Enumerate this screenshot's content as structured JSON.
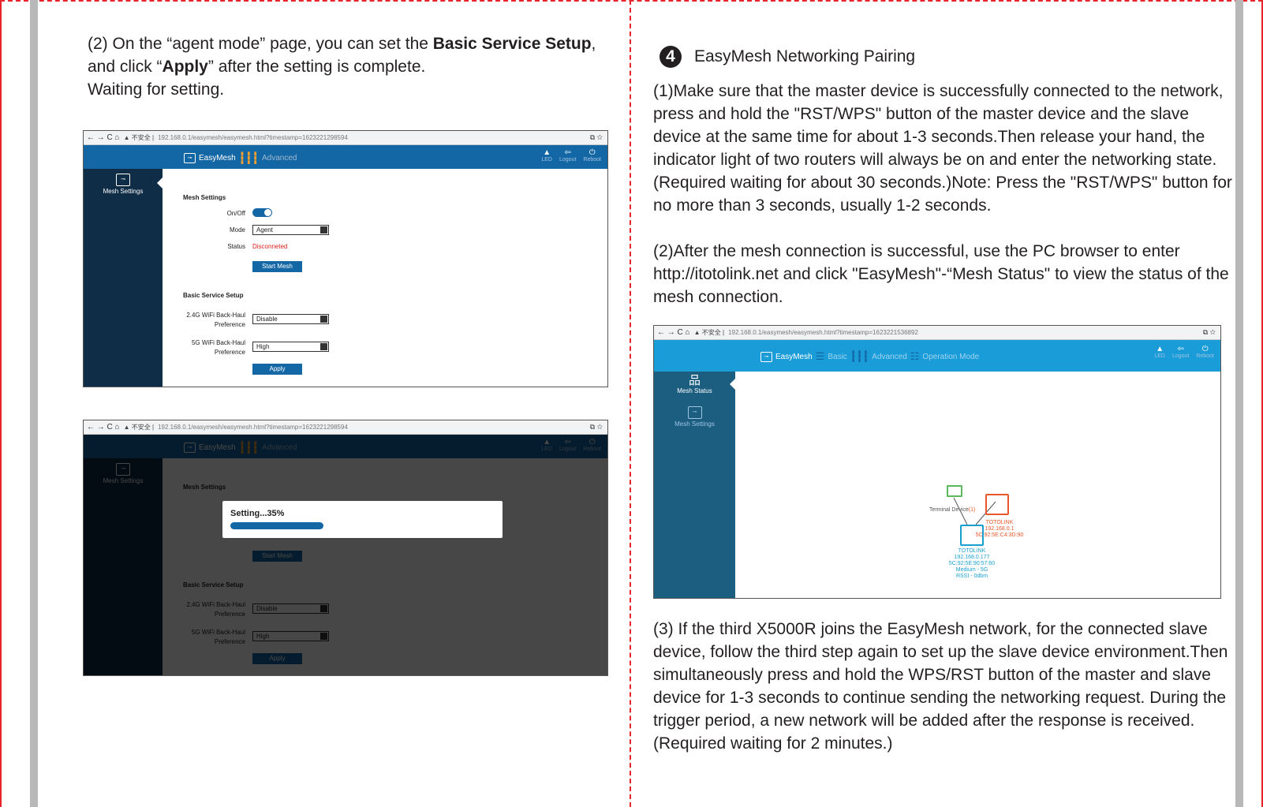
{
  "left": {
    "intro_1": "(2) On the “agent mode” page, you can set the ",
    "intro_bold_1": "Basic Service Setup",
    "intro_2": ", and click “",
    "intro_bold_2": "Apply",
    "intro_3": "” after the setting is complete.",
    "intro_4": "Waiting for setting.",
    "shot1": {
      "nav": "← → C ⌂",
      "secure": "▲ 不安全 |",
      "url": "192.168.0.1/easymesh/easymesh.html?timestamp=1623221298594",
      "tail": "⧉ ☆",
      "brand": "EasyMesh",
      "advanced": "Advanced",
      "led": "LED",
      "logout": "Logout",
      "reboot": "Reboot",
      "side_item": "Mesh Settings",
      "mesh_settings": "Mesh Settings",
      "onoff": "On/Off",
      "mode_label": "Mode",
      "mode_value": "Agent",
      "status_label": "Status",
      "status_value": "Disconneted",
      "start_mesh": "Start Mesh",
      "basic_service": "Basic Service Setup",
      "wifi24_1": "2.4G WiFi Back-Haul",
      "wifi24_2": "Preference",
      "wifi24_value": "Disable",
      "wifi5_1": "5G WiFi Back-Haul",
      "wifi5_2": "Preference",
      "wifi5_value": "High",
      "apply": "Apply"
    },
    "shot2": {
      "url": "192.168.0.1/easymesh/easymesh.html?timestamp=1623221298594",
      "dialog_text": "Setting...35%",
      "progress": 0.35
    }
  },
  "right": {
    "step_number": "4",
    "step_title": "EasyMesh Networking Pairing",
    "para1": "(1)Make sure that the master device is successfully connected to the network, press and hold the \"RST/WPS\" button of the master device and the slave device at the same time for about 1-3 seconds.Then release your hand, the indicator light of two routers will always be on and enter the networking state. (Required waiting for about 30 seconds.)Note: Press the \"RST/WPS\" button for no more than 3 seconds, usually 1-2 seconds.",
    "para2": "(2)After the mesh connection is successful, use the PC browser to enter http://itotolink.net and click \"EasyMesh\"-“Mesh Status\" to view the status of the mesh connection.",
    "shot3": {
      "nav": "← → C ⌂",
      "secure": "▲ 不安全 |",
      "url": "192.168.0.1/easymesh/easymesh.html?timestamp=1623221536892",
      "tail": "⧉ ☆",
      "brand": "EasyMesh",
      "basic": "Basic",
      "advanced": "Advanced",
      "operation": "Operation Mode",
      "led": "LED",
      "logout": "Logout",
      "reboot": "Reboot",
      "side_status": "Mesh Status",
      "side_settings": "Mesh Settings",
      "terminal": "Terminal Device",
      "terminal_count": "(1)",
      "master_name": "TOTOLINK",
      "master_ip": "192.168.0.1",
      "master_mac": "5C:92:5E:C4:3D:90",
      "slave_name": "TOTOLINK",
      "slave_ip": "192.168.0.177",
      "slave_mac": "5C:92:5E:90:57:60",
      "slave_link": "Medium - 5G",
      "slave_rssi": "RSSI - 0dbm"
    },
    "para3": "(3) If the third X5000R joins the EasyMesh network, for the connected slave device, follow the third step again to set up the slave device environment.Then simultaneously press and hold the WPS/RST button of the master and slave device for 1-3 seconds to continue sending the networking request. During the trigger period, a new network will be added after the response is received.(Required waiting for 2 minutes.)"
  },
  "colors": {
    "frame": "#e8232a",
    "router_blue": "#1467a5",
    "sidebar_dark": "#0f2d47",
    "mesh_sidebar": "#1b5e80",
    "master_node": "#e8582a",
    "slave_node": "#1aa0d0",
    "terminal_node": "#5cb85c"
  }
}
